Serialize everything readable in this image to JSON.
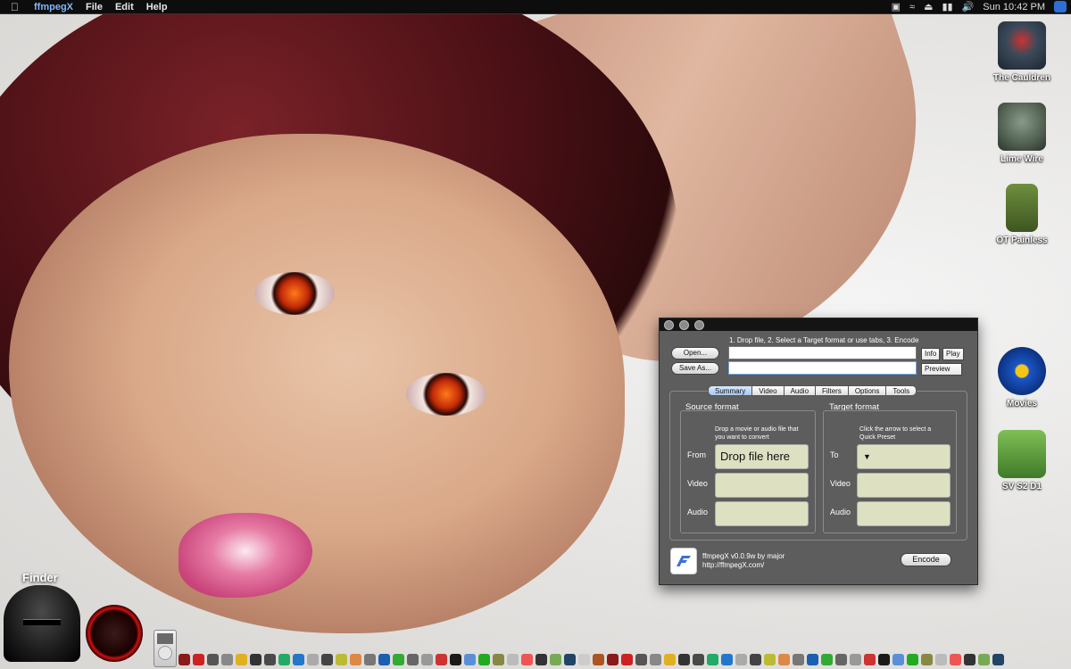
{
  "menubar": {
    "app_name": "ffmpegX",
    "menus": [
      "File",
      "Edit",
      "Help"
    ],
    "clock": "Sun 10:42 PM"
  },
  "desktop_icons": [
    {
      "label": "The Cauldren",
      "icon": "cauldron-icon",
      "color": "#3a4a5a"
    },
    {
      "label": "Lime Wire",
      "icon": "troll-icon",
      "color": "#5a6a5a"
    },
    {
      "label": "OT Painless",
      "icon": "tank-icon",
      "color": "#4f6b2e"
    },
    {
      "label": "Movies",
      "icon": "blockbuster-icon",
      "color": "#1a56c8"
    },
    {
      "label": "SV S2 D1",
      "icon": "folder-icon",
      "color": "#3f7a2a"
    }
  ],
  "window": {
    "hint": "1. Drop file, 2. Select a Target format or use tabs, 3. Encode",
    "open_label": "Open...",
    "saveas_label": "Save As...",
    "info_label": "Info",
    "play_label": "Play",
    "preview_label": "Preview",
    "tabs": [
      "Summary",
      "Video",
      "Audio",
      "Filters",
      "Options",
      "Tools"
    ],
    "source": {
      "title": "Source format",
      "desc": "Drop a movie or audio file that you want to convert",
      "from_label": "From",
      "from_value": "Drop file here",
      "video_label": "Video",
      "audio_label": "Audio"
    },
    "target": {
      "title": "Target format",
      "desc": "Click the arrow to select a Quick Preset",
      "to_label": "To",
      "video_label": "Video",
      "audio_label": "Audio"
    },
    "credit_line1": "ffmpegX v0.0.9w by major",
    "credit_line2": "http://ffmpegX.com/",
    "encode_label": "Encode"
  },
  "dock": {
    "finder_label": "Finder"
  }
}
